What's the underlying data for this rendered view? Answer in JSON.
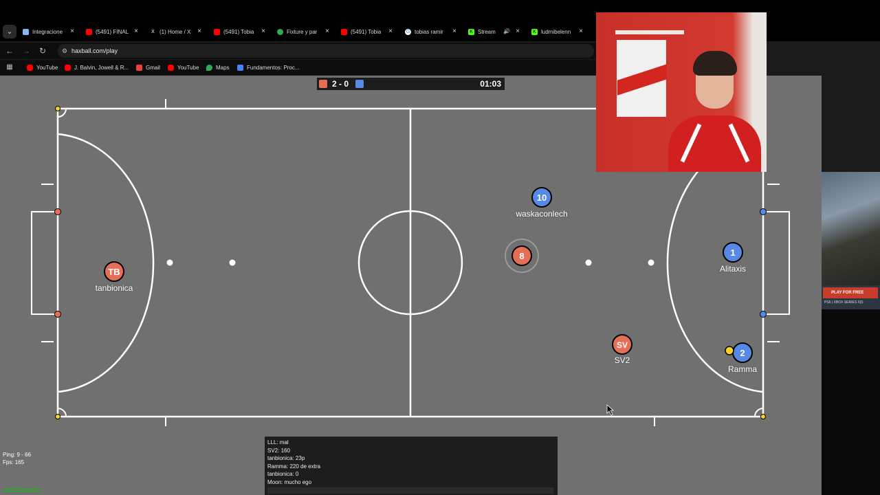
{
  "browser": {
    "tabs": [
      {
        "title": "Integracione",
        "favicon_color": "#8ab4f8"
      },
      {
        "title": "(5491) FINAL",
        "favicon_color": "#ff0000"
      },
      {
        "title": "(1) Home / X",
        "favicon_color": "#ffffff"
      },
      {
        "title": "(5491) Tobia",
        "favicon_color": "#ff0000"
      },
      {
        "title": "Fixture y par",
        "favicon_color": "#34a853"
      },
      {
        "title": "(5491) Tobia",
        "favicon_color": "#ff0000"
      },
      {
        "title": "tobias ramir",
        "favicon_color": "#4285f4"
      },
      {
        "title": "Stream",
        "favicon_color": "#53fc18"
      },
      {
        "title": "ludmibelenn",
        "favicon_color": "#53fc18"
      }
    ],
    "url": "haxball.com/play",
    "bookmarks": [
      {
        "label": "YouTube",
        "favicon_color": "#ff0000"
      },
      {
        "label": "J. Balvin, Jowell & R...",
        "favicon_color": "#ff0000"
      },
      {
        "label": "Gmail",
        "favicon_color": "#ea4335"
      },
      {
        "label": "YouTube",
        "favicon_color": "#ff0000"
      },
      {
        "label": "Maps",
        "favicon_color": "#34a853"
      },
      {
        "label": "Fundamentos: Proc...",
        "favicon_color": "#4285f4"
      }
    ]
  },
  "game": {
    "score": "2 - 0",
    "time": "01:03",
    "red_color": "#e56e56",
    "blue_color": "#5689e5",
    "players": [
      {
        "team": "red",
        "avatar": "TB",
        "name": "tanbionica"
      },
      {
        "team": "red",
        "avatar": "8",
        "name": ""
      },
      {
        "team": "red",
        "avatar": "SV",
        "name": "SV2"
      },
      {
        "team": "blue",
        "avatar": "10",
        "name": "waskaconlech"
      },
      {
        "team": "blue",
        "avatar": "1",
        "name": "Alitaxis"
      },
      {
        "team": "blue",
        "avatar": "2",
        "name": "Ramma"
      }
    ]
  },
  "stats": {
    "ping": "Ping: 9 - 66",
    "fps": "Fps: 165"
  },
  "chat": {
    "messages": [
      "LLL: mal",
      "SV2: 160",
      "tanbionica: 23p",
      "Ramma: 220 de extra",
      "tanbionica: 0",
      "Moon: mucho ego"
    ]
  },
  "ad": {
    "button": "PLAY FOR FREE",
    "brands": "PS5 | XBOX SERIES X|S"
  }
}
